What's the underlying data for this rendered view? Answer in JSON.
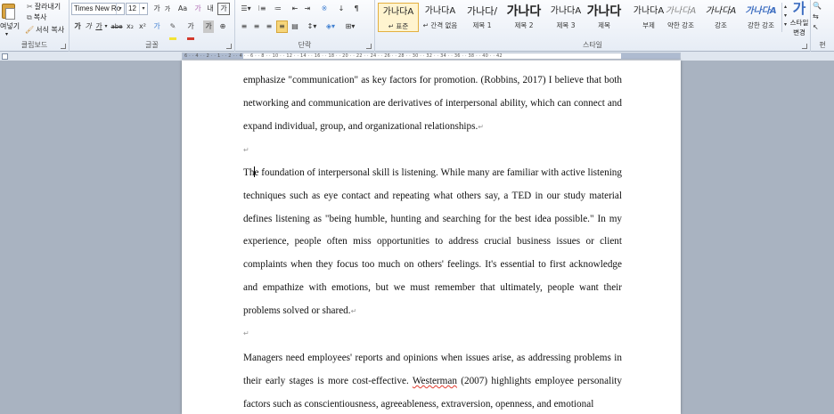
{
  "clipboard": {
    "cut": "잘라내기",
    "copy": "복사",
    "paste": "여넣기",
    "format_painter": "서식 복사",
    "label": "클립보드"
  },
  "font": {
    "name": "Times New Ro",
    "size": "12",
    "label": "글꼴",
    "grow": "가",
    "shrink": "가",
    "change_case": "Aa",
    "clear": "가",
    "phonetic": "내",
    "char_border": "가",
    "bold": "가",
    "italic": "가",
    "underline": "가",
    "strike": "abe",
    "subscript": "x₂",
    "superscript": "x²",
    "text_effect": "가",
    "highlight_color": "#f3e335",
    "font_color": "#d33a2c",
    "shading": "가",
    "char_box": "가"
  },
  "paragraph": {
    "label": "단락",
    "sort": "↓"
  },
  "styles": {
    "label": "스타일",
    "items": [
      {
        "sample": "가나다A",
        "name": "↵ 표준"
      },
      {
        "sample": "가나다A",
        "name": "↵ 간격 없음"
      },
      {
        "sample": "가나다/",
        "name": "제목 1"
      },
      {
        "sample": "가나다",
        "name": "제목 2"
      },
      {
        "sample": "가나다A",
        "name": "제목 3"
      },
      {
        "sample": "가나다",
        "name": "제목"
      },
      {
        "sample": "가나다A",
        "name": "부제"
      },
      {
        "sample": "가나다A",
        "name": "약한 강조"
      },
      {
        "sample": "가나다A",
        "name": "강조"
      },
      {
        "sample": "가나다A",
        "name": "강한 강조"
      }
    ],
    "change_styles": "스타일\n변경",
    "change_styles_line1": "스타일",
    "change_styles_line2": "변경",
    "big_sample": "가"
  },
  "editing": {
    "label": "편"
  },
  "ruler": {
    "ticks": "6 · · 4 · · 2 · · 1 · · 2 · · 4 · · 6 · · 8 · · 10 · · 12 · · 14 · · 16 · · 18 · · 20 · · 22 · · 24 · · 26 · · 28 · · 30 · · 32 · · 34 · · 36 · · 38 · · 40 · · 42"
  },
  "document": {
    "p1": "emphasize \"communication\" as key factors for promotion. (Robbins, 2017)   I believe that both networking and communication are derivatives of interpersonal ability, which can connect and expand individual, group, and organizational relationships.",
    "p2_start": "Th",
    "p2_rest": "e foundation of interpersonal skill is listening. While many are familiar with active listening techniques such as eye contact and repeating what others say, a TED in our study material defines listening as \"being humble, hunting and searching for the best idea possible.\" In my experience, people often miss opportunities to address crucial business issues or client complaints when they focus too much on others' feelings. It's essential to first acknowledge and empathize with emotions, but we must remember that ultimately, people want their problems solved or shared.",
    "p3_before": "Managers need employees' reports and opinions when issues arise, as addressing problems in their early stages is more cost-effective. ",
    "p3_misspelled": "Westerman",
    "p3_after": " (2007) highlights employee personality factors such as conscientiousness, agreeableness, extraversion, openness, and emotional",
    "para_mark": "↵"
  }
}
